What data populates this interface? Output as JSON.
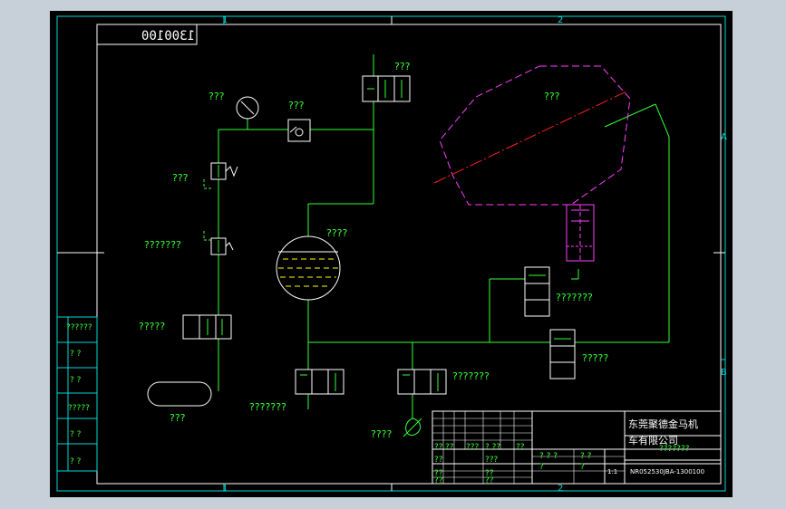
{
  "drawing": {
    "code_box": "1300100",
    "zones": {
      "top_1": "1",
      "top_2": "2",
      "bottom_1": "1",
      "bottom_2": "2",
      "side_a": "A",
      "side_b": "B"
    },
    "labels": {
      "gauge": "???",
      "check_valve": "???",
      "valve_top": "???",
      "filter_region": "???",
      "relief_valve": "???",
      "pressure_switch": "???????",
      "receiver": "????",
      "valve_left": "?????",
      "tank": "???",
      "valve_bottom_left": "???????",
      "valve_bottom_mid": "???????",
      "pump": "????",
      "valve_right_upper": "???????",
      "valve_right_lower": "?????"
    },
    "left_side_table": [
      "??????",
      "?  ?",
      "?  ?",
      "?????",
      "?  ?",
      "?  ?"
    ],
    "title_block": {
      "company_line1": "东莞聚德金马机",
      "company_line2": "车有限公司",
      "part_name": "???????",
      "drawing_no": "NR052530JBA-1300100",
      "scale": "1:1",
      "cells_left": [
        "??",
        "??",
        "???",
        "?  ??",
        "??",
        "??",
        "???",
        "??",
        "??",
        "??",
        "??"
      ],
      "cells_mid": [
        "? ? ?",
        "? ?",
        "?",
        "?"
      ]
    }
  }
}
